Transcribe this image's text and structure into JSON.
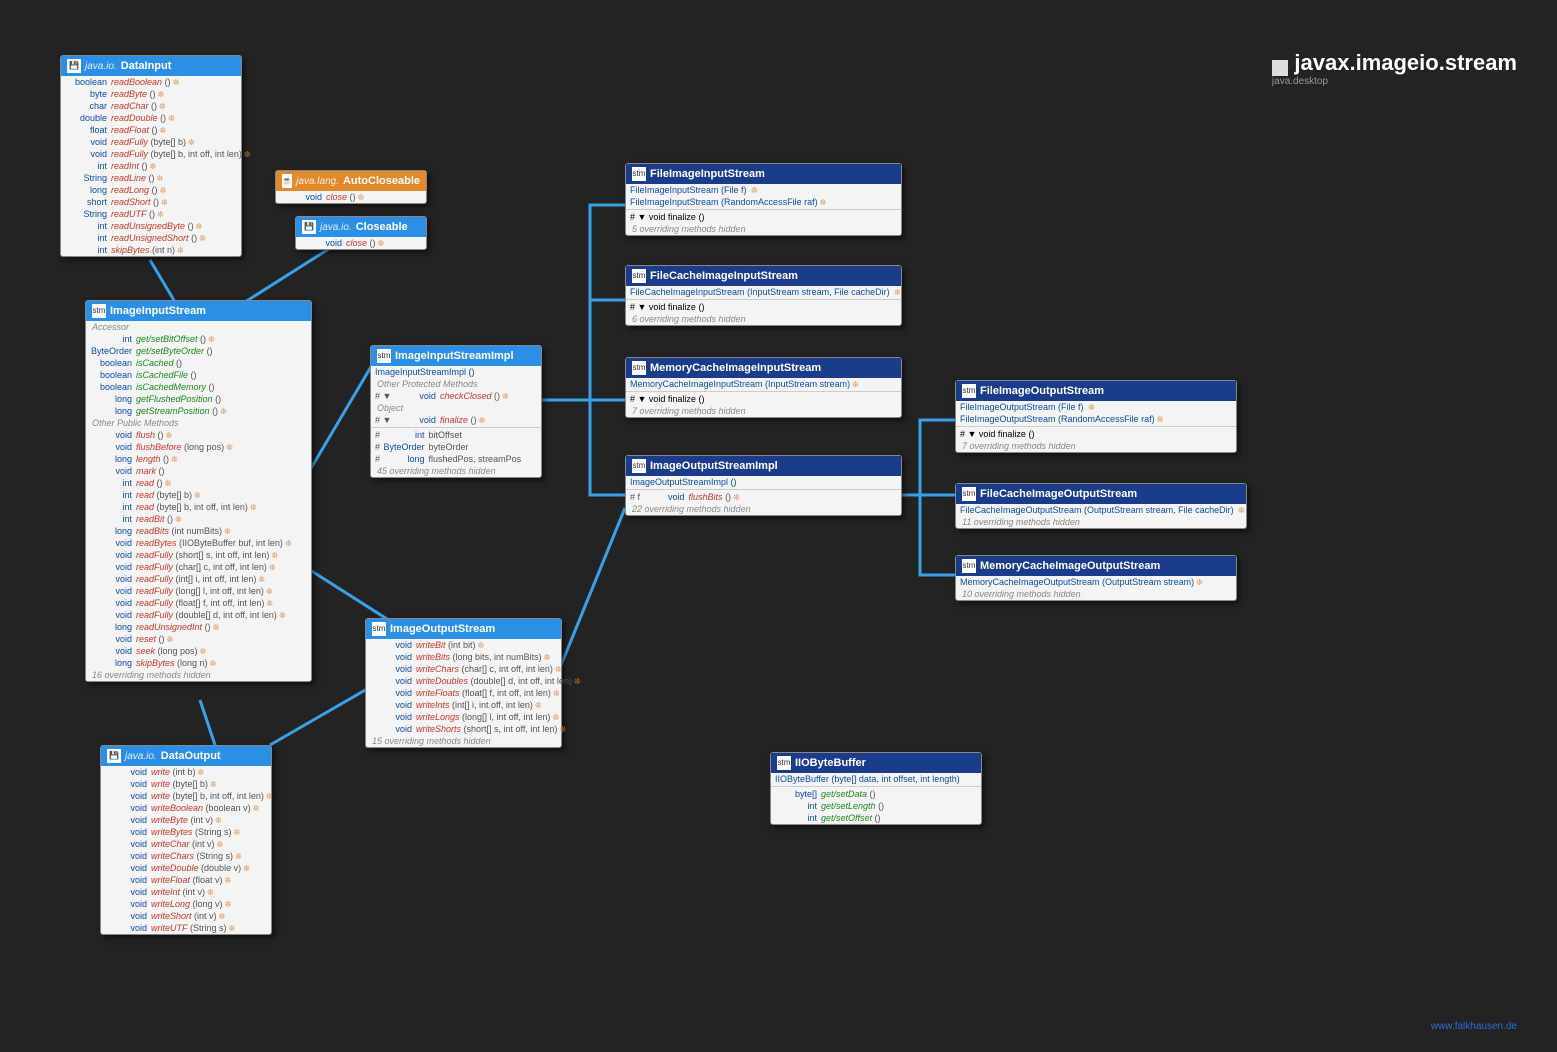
{
  "page": {
    "title": "javax.imageio.stream",
    "subtitle": "java.desktop",
    "footer": "www.falkhausen.de"
  },
  "dataInput": {
    "pkg": "java.io.",
    "name": "DataInput",
    "rows": [
      {
        "r": "boolean",
        "m": "readBoolean",
        "p": "()",
        "t": 1
      },
      {
        "r": "byte",
        "m": "readByte",
        "p": "()",
        "t": 1
      },
      {
        "r": "char",
        "m": "readChar",
        "p": "()",
        "t": 1
      },
      {
        "r": "double",
        "m": "readDouble",
        "p": "()",
        "t": 1
      },
      {
        "r": "float",
        "m": "readFloat",
        "p": "()",
        "t": 1
      },
      {
        "r": "void",
        "m": "readFully",
        "p": "(byte[] b)",
        "t": 1
      },
      {
        "r": "void",
        "m": "readFully",
        "p": "(byte[] b, int off, int len)",
        "t": 1
      },
      {
        "r": "int",
        "m": "readInt",
        "p": "()",
        "t": 1
      },
      {
        "r": "String",
        "m": "readLine",
        "p": "()",
        "t": 1
      },
      {
        "r": "long",
        "m": "readLong",
        "p": "()",
        "t": 1
      },
      {
        "r": "short",
        "m": "readShort",
        "p": "()",
        "t": 1
      },
      {
        "r": "String",
        "m": "readUTF",
        "p": "()",
        "t": 1
      },
      {
        "r": "int",
        "m": "readUnsignedByte",
        "p": "()",
        "t": 1
      },
      {
        "r": "int",
        "m": "readUnsignedShort",
        "p": "()",
        "t": 1
      },
      {
        "r": "int",
        "m": "skipBytes",
        "p": "(int n)",
        "t": 1
      }
    ]
  },
  "autoCloseable": {
    "pkg": "java.lang.",
    "name": "AutoCloseable",
    "rows": [
      {
        "r": "void",
        "m": "close",
        "p": "()",
        "t": 1
      }
    ]
  },
  "closeable": {
    "pkg": "java.io.",
    "name": "Closeable",
    "rows": [
      {
        "r": "void",
        "m": "close",
        "p": "()",
        "t": 1
      }
    ]
  },
  "iis": {
    "name": "ImageInputStream",
    "s1": "Accessor",
    "a": [
      {
        "r": "int",
        "m": "get/setBitOffset",
        "p": "()",
        "t": 1,
        "g": 1
      },
      {
        "r": "ByteOrder",
        "m": "get/setByteOrder",
        "p": "()",
        "g": 1
      },
      {
        "r": "boolean",
        "m": "isCached",
        "p": "()",
        "g": 1
      },
      {
        "r": "boolean",
        "m": "isCachedFile",
        "p": "()",
        "g": 1
      },
      {
        "r": "boolean",
        "m": "isCachedMemory",
        "p": "()",
        "g": 1
      },
      {
        "r": "long",
        "m": "getFlushedPosition",
        "p": "()",
        "g": 1
      },
      {
        "r": "long",
        "m": "getStreamPosition",
        "p": "()",
        "t": 1,
        "g": 1
      }
    ],
    "s2": "Other Public Methods",
    "b": [
      {
        "r": "void",
        "m": "flush",
        "p": "()",
        "t": 1
      },
      {
        "r": "void",
        "m": "flushBefore",
        "p": "(long pos)",
        "t": 1
      },
      {
        "r": "long",
        "m": "length",
        "p": "()",
        "t": 1
      },
      {
        "r": "void",
        "m": "mark",
        "p": "()"
      },
      {
        "r": "int",
        "m": "read",
        "p": "()",
        "t": 1
      },
      {
        "r": "int",
        "m": "read",
        "p": "(byte[] b)",
        "t": 1
      },
      {
        "r": "int",
        "m": "read",
        "p": "(byte[] b, int off, int len)",
        "t": 1
      },
      {
        "r": "int",
        "m": "readBit",
        "p": "()",
        "t": 1
      },
      {
        "r": "long",
        "m": "readBits",
        "p": "(int numBits)",
        "t": 1
      },
      {
        "r": "void",
        "m": "readBytes",
        "p": "(IIOByteBuffer buf, int len)",
        "t": 1
      },
      {
        "r": "void",
        "m": "readFully",
        "p": "(short[] s, int off, int len)",
        "t": 1
      },
      {
        "r": "void",
        "m": "readFully",
        "p": "(char[] c, int off, int len)",
        "t": 1
      },
      {
        "r": "void",
        "m": "readFully",
        "p": "(int[] i, int off, int len)",
        "t": 1
      },
      {
        "r": "void",
        "m": "readFully",
        "p": "(long[] l, int off, int len)",
        "t": 1
      },
      {
        "r": "void",
        "m": "readFully",
        "p": "(float[] f, int off, int len)",
        "t": 1
      },
      {
        "r": "void",
        "m": "readFully",
        "p": "(double[] d, int off, int len)",
        "t": 1
      },
      {
        "r": "long",
        "m": "readUnsignedInt",
        "p": "()",
        "t": 1
      },
      {
        "r": "void",
        "m": "reset",
        "p": "()",
        "t": 1
      },
      {
        "r": "void",
        "m": "seek",
        "p": "(long pos)",
        "t": 1
      },
      {
        "r": "long",
        "m": "skipBytes",
        "p": "(long n)",
        "t": 1
      }
    ],
    "note": "16 overriding methods hidden"
  },
  "dataOutput": {
    "pkg": "java.io.",
    "name": "DataOutput",
    "rows": [
      {
        "r": "void",
        "m": "write",
        "p": "(int b)",
        "t": 1
      },
      {
        "r": "void",
        "m": "write",
        "p": "(byte[] b)",
        "t": 1
      },
      {
        "r": "void",
        "m": "write",
        "p": "(byte[] b, int off, int len)",
        "t": 1
      },
      {
        "r": "void",
        "m": "writeBoolean",
        "p": "(boolean v)",
        "t": 1
      },
      {
        "r": "void",
        "m": "writeByte",
        "p": "(int v)",
        "t": 1
      },
      {
        "r": "void",
        "m": "writeBytes",
        "p": "(String s)",
        "t": 1
      },
      {
        "r": "void",
        "m": "writeChar",
        "p": "(int v)",
        "t": 1
      },
      {
        "r": "void",
        "m": "writeChars",
        "p": "(String s)",
        "t": 1
      },
      {
        "r": "void",
        "m": "writeDouble",
        "p": "(double v)",
        "t": 1
      },
      {
        "r": "void",
        "m": "writeFloat",
        "p": "(float v)",
        "t": 1
      },
      {
        "r": "void",
        "m": "writeInt",
        "p": "(int v)",
        "t": 1
      },
      {
        "r": "void",
        "m": "writeLong",
        "p": "(long v)",
        "t": 1
      },
      {
        "r": "void",
        "m": "writeShort",
        "p": "(int v)",
        "t": 1
      },
      {
        "r": "void",
        "m": "writeUTF",
        "p": "(String s)",
        "t": 1
      }
    ]
  },
  "iisImpl": {
    "name": "ImageInputStreamImpl",
    "ctor": "ImageInputStreamImpl ()",
    "s1": "Other Protected Methods",
    "a": [
      {
        "pre": "# ▼",
        "r": "void",
        "m": "checkClosed",
        "p": "()",
        "t": 1
      }
    ],
    "s2": "Object",
    "b": [
      {
        "pre": "# ▼",
        "r": "void",
        "m": "finalize",
        "p": "()",
        "t": 1
      }
    ],
    "fields": [
      {
        "pre": "#",
        "r": "int",
        "n": "bitOffset"
      },
      {
        "pre": "#",
        "r": "ByteOrder",
        "n": "byteOrder"
      },
      {
        "pre": "#",
        "r": "long",
        "n": "flushedPos, streamPos"
      }
    ],
    "note": "45 overriding methods hidden"
  },
  "ios": {
    "name": "ImageOutputStream",
    "rows": [
      {
        "r": "void",
        "m": "writeBit",
        "p": "(int bit)",
        "t": 1
      },
      {
        "r": "void",
        "m": "writeBits",
        "p": "(long bits, int numBits)",
        "t": 1
      },
      {
        "r": "void",
        "m": "writeChars",
        "p": "(char[] c, int off, int len)",
        "t": 1
      },
      {
        "r": "void",
        "m": "writeDoubles",
        "p": "(double[] d, int off, int len)",
        "t": 1
      },
      {
        "r": "void",
        "m": "writeFloats",
        "p": "(float[] f, int off, int len)",
        "t": 1
      },
      {
        "r": "void",
        "m": "writeInts",
        "p": "(int[] i, int off, int len)",
        "t": 1
      },
      {
        "r": "void",
        "m": "writeLongs",
        "p": "(long[] l, int off, int len)",
        "t": 1
      },
      {
        "r": "void",
        "m": "writeShorts",
        "p": "(short[] s, int off, int len)",
        "t": 1
      }
    ],
    "note": "15 overriding methods hidden"
  },
  "fiis": {
    "name": "FileImageInputStream",
    "ctors": [
      "FileImageInputStream (File f) ",
      "FileImageInputStream (RandomAccessFile raf)"
    ],
    "fin": "# ▼ void  finalize () ",
    "note": "5 overriding methods hidden"
  },
  "fciis": {
    "name": "FileCacheImageInputStream",
    "ctors": [
      "FileCacheImageInputStream (InputStream stream, File cacheDir) "
    ],
    "fin": "# ▼ void  finalize () ",
    "note": "6 overriding methods hidden"
  },
  "mciis": {
    "name": "MemoryCacheImageInputStream",
    "ctors": [
      "MemoryCacheImageInputStream (InputStream stream)"
    ],
    "fin": "# ▼ void  finalize () ",
    "note": "7 overriding methods hidden"
  },
  "iosImpl": {
    "name": "ImageOutputStreamImpl",
    "ctor": "ImageOutputStreamImpl ()",
    "row": {
      "pre": "# f",
      "r": "void",
      "m": "flushBits",
      "p": "()",
      "t": 1
    },
    "note": "22 overriding methods hidden"
  },
  "fios": {
    "name": "FileImageOutputStream",
    "ctors": [
      "FileImageOutputStream (File f) ",
      "FileImageOutputStream (RandomAccessFile raf)"
    ],
    "fin": "# ▼ void  finalize () ",
    "note": "7 overriding methods hidden"
  },
  "fcios": {
    "name": "FileCacheImageOutputStream",
    "ctors": [
      "FileCacheImageOutputStream (OutputStream stream, File cacheDir) "
    ],
    "note": "11 overriding methods hidden"
  },
  "mcios": {
    "name": "MemoryCacheImageOutputStream",
    "ctors": [
      "MemoryCacheImageOutputStream (OutputStream stream)"
    ],
    "note": "10 overriding methods hidden"
  },
  "iiobb": {
    "name": "IIOByteBuffer",
    "ctor": "IIOByteBuffer (byte[] data, int offset, int length)",
    "rows": [
      {
        "r": "byte[]",
        "m": "get/setData",
        "p": "()",
        "g": 1
      },
      {
        "r": "int",
        "m": "get/setLength",
        "p": "()",
        "g": 1
      },
      {
        "r": "int",
        "m": "get/setOffset",
        "p": "()",
        "g": 1
      }
    ]
  }
}
